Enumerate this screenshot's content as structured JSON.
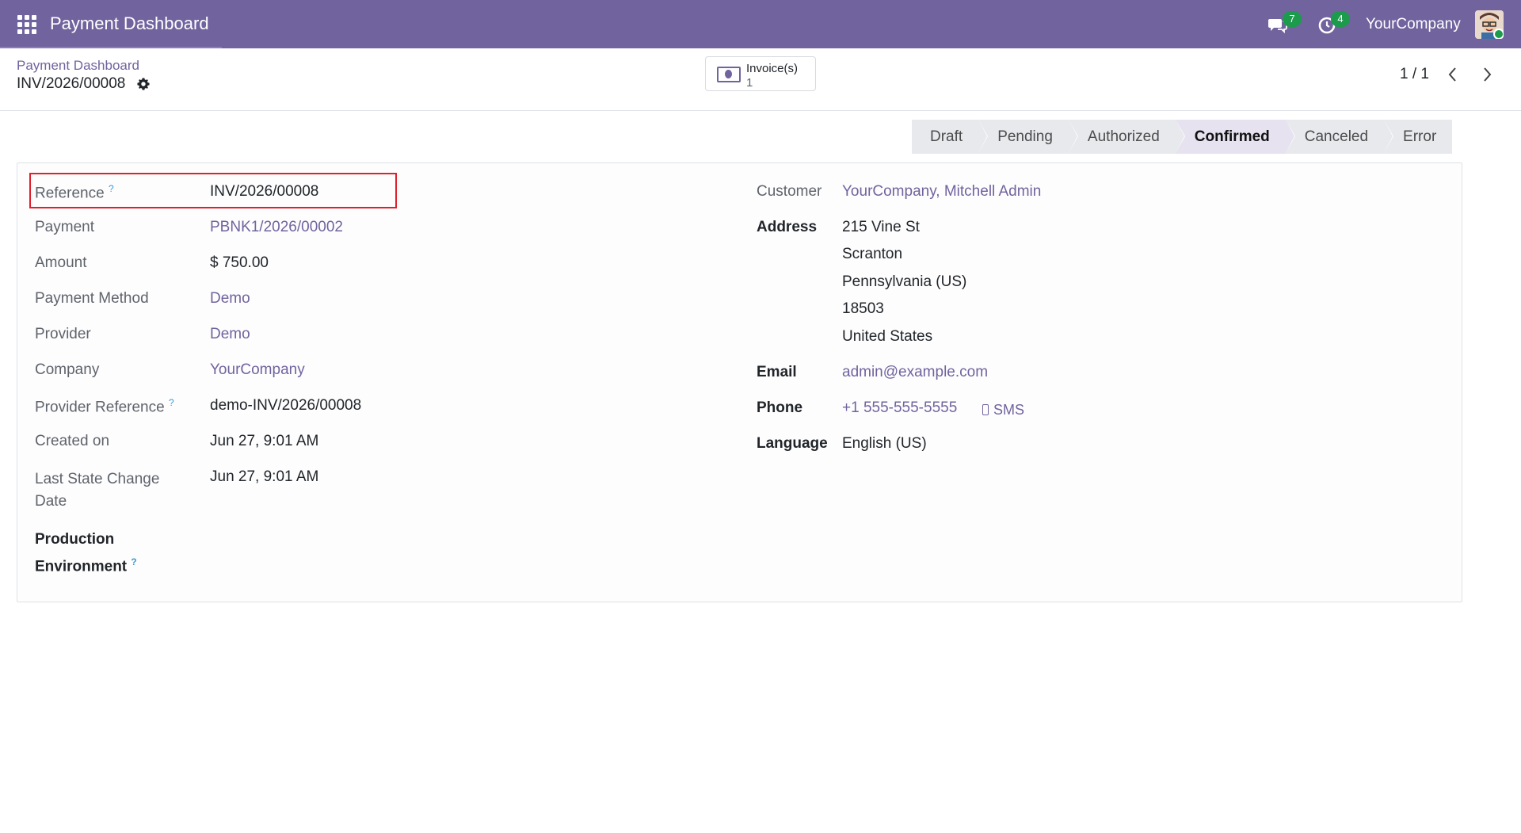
{
  "navbar": {
    "title": "Payment Dashboard",
    "messages_count": "7",
    "activities_count": "4",
    "company": "YourCompany"
  },
  "control": {
    "breadcrumb": "Payment Dashboard",
    "record_name": "INV/2026/00008",
    "smart_button": {
      "label": "Invoice(s)",
      "count": "1"
    },
    "pager": "1 / 1"
  },
  "statusbar": {
    "stages": [
      "Draft",
      "Pending",
      "Authorized",
      "Confirmed",
      "Canceled",
      "Error"
    ],
    "active": "Confirmed"
  },
  "left_fields": [
    {
      "label": "Reference",
      "value": "INV/2026/00008"
    },
    {
      "label": "Payment",
      "value": "PBNK1/2026/00002"
    },
    {
      "label": "Amount",
      "value": "$ 750.00"
    },
    {
      "label": "Payment Method",
      "value": "Demo"
    },
    {
      "label": "Provider",
      "value": "Demo"
    },
    {
      "label": "Company",
      "value": "YourCompany"
    },
    {
      "label": "Provider Reference",
      "value": "demo-INV/2026/00008"
    },
    {
      "label": "Created on",
      "value": "Jun 27, 9:01 AM"
    },
    {
      "label_line1": "Last State Change",
      "label_line2": "Date",
      "value": "Jun 27, 9:01 AM"
    },
    {
      "label_line1": "Production",
      "label_line2": "Environment"
    }
  ],
  "help_marker": "?",
  "right_fields": {
    "customer_label": "Customer",
    "customer_value": "YourCompany, Mitchell Admin",
    "address_label": "Address",
    "address_lines": [
      "215 Vine St",
      "Scranton",
      "Pennsylvania (US)",
      "18503",
      "United States"
    ],
    "email_label": "Email",
    "email_value": "admin@example.com",
    "phone_label": "Phone",
    "phone_value": "+1 555-555-5555",
    "sms_label": "SMS",
    "language_label": "Language",
    "language_value": "English (US)"
  },
  "colors": {
    "brand": "#71639e",
    "badge": "#1b9b4b",
    "highlight": "#e0202a"
  }
}
